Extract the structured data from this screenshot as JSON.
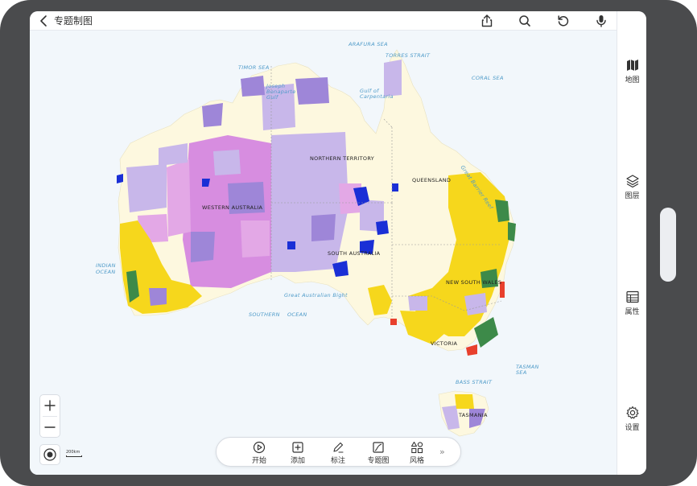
{
  "header": {
    "title": "专题制图",
    "icons": [
      "back-icon",
      "share-icon",
      "search-icon",
      "refresh-icon",
      "microphone-icon"
    ]
  },
  "map": {
    "sea_labels": {
      "arafura": "ARAFURA SEA",
      "torres": "TORRES STRAIT",
      "timor": "TIMOR SEA",
      "coral": "CORAL SEA",
      "joseph": "Joseph Bonaparte Gulf",
      "carpentaria": "Gulf of Carpentaria",
      "barrier": "Great Barrier Reef",
      "indian_1": "INDIAN",
      "indian_2": "OCEAN",
      "southern_1": "SOUTHERN",
      "southern_2": "OCEAN",
      "bight": "Great Australian Bight",
      "tasman_1": "TASMAN",
      "tasman_2": "SEA",
      "bass": "BASS STRAIT"
    },
    "region_labels": {
      "nt": "NORTHERN TERRITORY",
      "qld": "QUEENSLAND",
      "wa": "WESTERN AUSTRALIA",
      "sa": "SOUTH AUSTRALIA",
      "nsw": "NEW SOUTH WALES",
      "vic": "VICTORIA",
      "tas": "TASMANIA"
    },
    "scale_label": "200km",
    "colors": {
      "land_base": "#fdf8df",
      "pastoral_violet": "#c8b7ea",
      "dark_purple": "#9e86d8",
      "pink": "#e3a8e6",
      "magenta": "#d78de0",
      "yellow": "#f6d71c",
      "green": "#3d8a49",
      "water_blue": "#1a2fd6",
      "red": "#e8402d"
    }
  },
  "right_panel": {
    "items": [
      {
        "label": "地图",
        "icon": "map-icon"
      },
      {
        "label": "图层",
        "icon": "layers-icon"
      },
      {
        "label": "属性",
        "icon": "attributes-table-icon"
      },
      {
        "label": "设置",
        "icon": "gear-icon"
      }
    ]
  },
  "zoom": {
    "plus": "+",
    "minus": "−"
  },
  "toolbar": {
    "items": [
      {
        "label": "开始",
        "icon": "play-icon"
      },
      {
        "label": "添加",
        "icon": "add-square-icon"
      },
      {
        "label": "标注",
        "icon": "pencil-icon"
      },
      {
        "label": "专题图",
        "icon": "thematic-map-icon"
      },
      {
        "label": "风格",
        "icon": "style-shapes-icon"
      }
    ],
    "more": "»"
  }
}
